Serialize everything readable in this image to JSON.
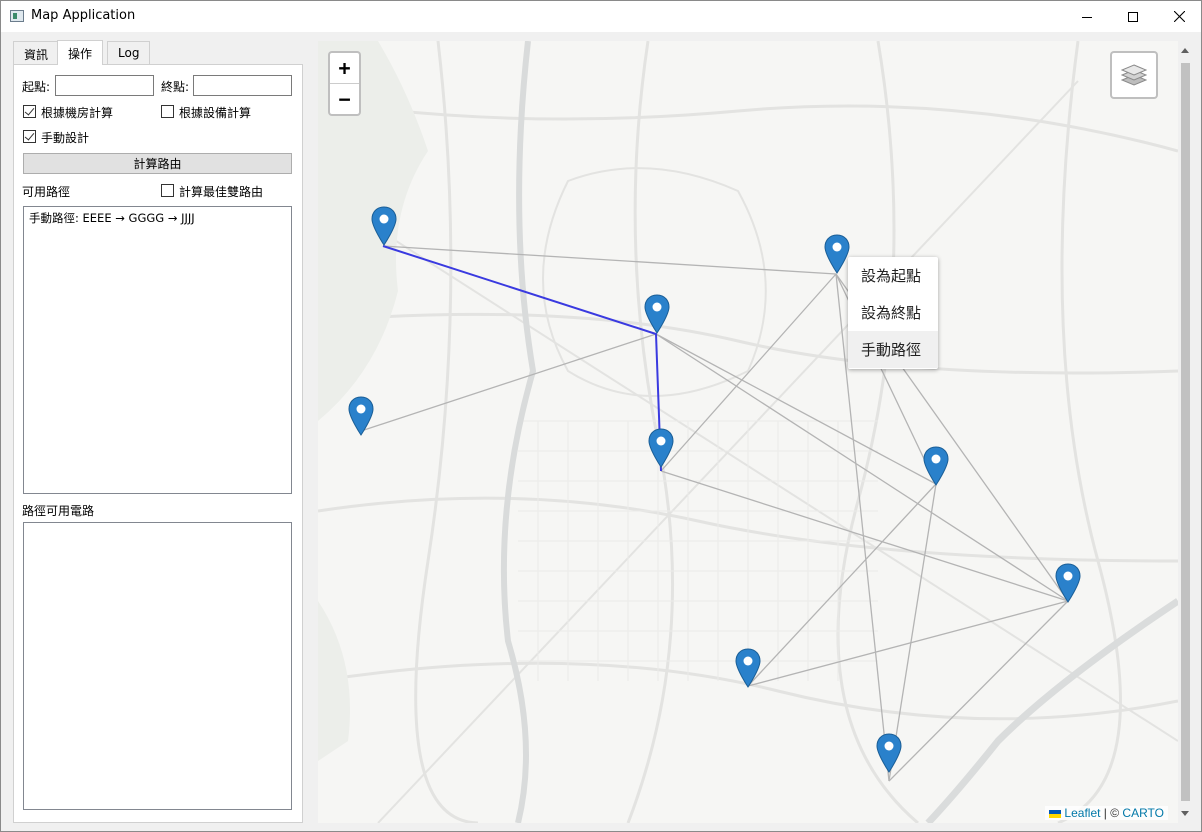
{
  "window": {
    "title": "Map Application"
  },
  "tabs": [
    {
      "label": "資訊"
    },
    {
      "label": "操作"
    },
    {
      "label": "Log"
    }
  ],
  "form": {
    "start_label": "起點:",
    "start_value": "",
    "end_label": "終點:",
    "end_value": "",
    "cb_room_label": "根據機房計算",
    "cb_room_checked": true,
    "cb_equip_label": "根據設備計算",
    "cb_equip_checked": false,
    "cb_manual_label": "手動設計",
    "cb_manual_checked": true,
    "calc_button": "計算路由",
    "routes_label": "可用路徑",
    "cb_best_label": "計算最佳雙路由",
    "cb_best_checked": false,
    "routes": [
      "手動路徑: EEEE → GGGG → JJJJ"
    ],
    "circuits_label": "路徑可用電路",
    "circuits": []
  },
  "map": {
    "zoom_in": "+",
    "zoom_out": "−",
    "layers_icon": "layers-icon",
    "context_menu": [
      "設為起點",
      "設為終點",
      "手動路徑"
    ],
    "context_menu_highlighted": 2,
    "attribution_leaflet": "Leaflet",
    "attribution_sep": " | © ",
    "attribution_carto": "CARTO",
    "colors": {
      "marker": "#2a81cb",
      "route": "#3a3ae0",
      "links": "#b4b4b4"
    }
  }
}
